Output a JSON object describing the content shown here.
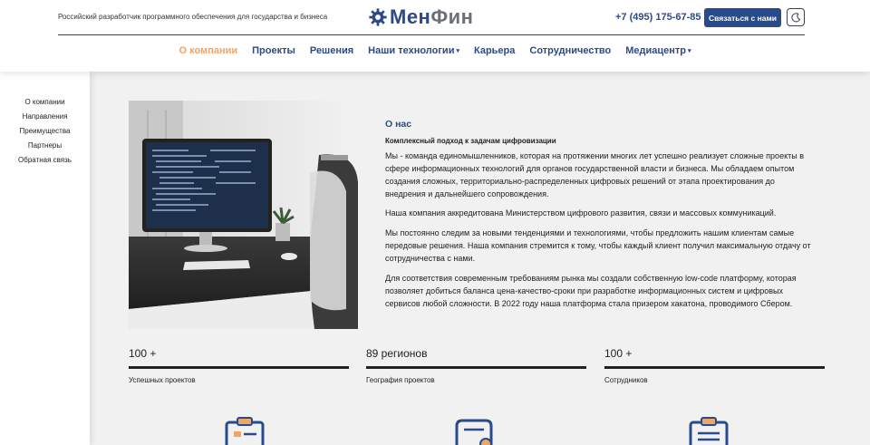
{
  "header": {
    "tagline": "Российский разработчик программного обеспечения для государства и бизнеса",
    "logo_left": "Мен",
    "logo_right": "Фин",
    "phone": "+7 (495) 175-67-85",
    "contact_button": "Связаться с нами"
  },
  "nav": {
    "items": [
      {
        "label": "О компании",
        "active": true
      },
      {
        "label": "Проекты"
      },
      {
        "label": "Решения"
      },
      {
        "label": "Наши технологии",
        "dropdown": true
      },
      {
        "label": "Карьера"
      },
      {
        "label": "Сотрудничество"
      },
      {
        "label": "Медиацентр",
        "dropdown": true
      }
    ]
  },
  "sidebar": {
    "items": [
      {
        "label": "О компании"
      },
      {
        "label": "Направления"
      },
      {
        "label": "Преимущества"
      },
      {
        "label": "Партнеры"
      },
      {
        "label": "Обратная связь"
      }
    ]
  },
  "about": {
    "title": "О нас",
    "subtitle": "Комплексный подход к задачам цифровизации",
    "paragraphs": [
      "Мы - команда единомышленников, которая на протяжении многих лет успешно реализует сложные проекты в сфере информационных технологий для органов государственной власти и бизнеса. Мы обладаем опытом создания сложных, территориально-распределенных цифровых решений от этапа проектирования до внедрения и дальнейшего сопровождения.",
      "Наша компания аккредитована Министерством цифрового развития, связи и массовых коммуникаций.",
      "Мы постоянно следим за новыми тенденциями и технологиями, чтобы предложить нашим клиентам самые передовые решения. Наша компания стремится к тому, чтобы каждый клиент получил максимальную отдачу от сотрудничества с нами.",
      "Для соответствия современным требованиям рынка мы создали собственную low-code платформу, которая позволяет добиться баланса цена-качество-сроки при разработке информационных систем и цифровых сервисов любой сложности. В 2022 году наша платформа стала призером хакатона, проводимого Сбером."
    ]
  },
  "stats": [
    {
      "value": "100 +",
      "label": "Успешных проектов"
    },
    {
      "value": "89 регионов",
      "label": "География проектов"
    },
    {
      "value": "100 +",
      "label": "Сотрудников"
    }
  ],
  "colors": {
    "brand": "#2e4a86",
    "accent": "#f0a468",
    "button": "#284b8c"
  }
}
